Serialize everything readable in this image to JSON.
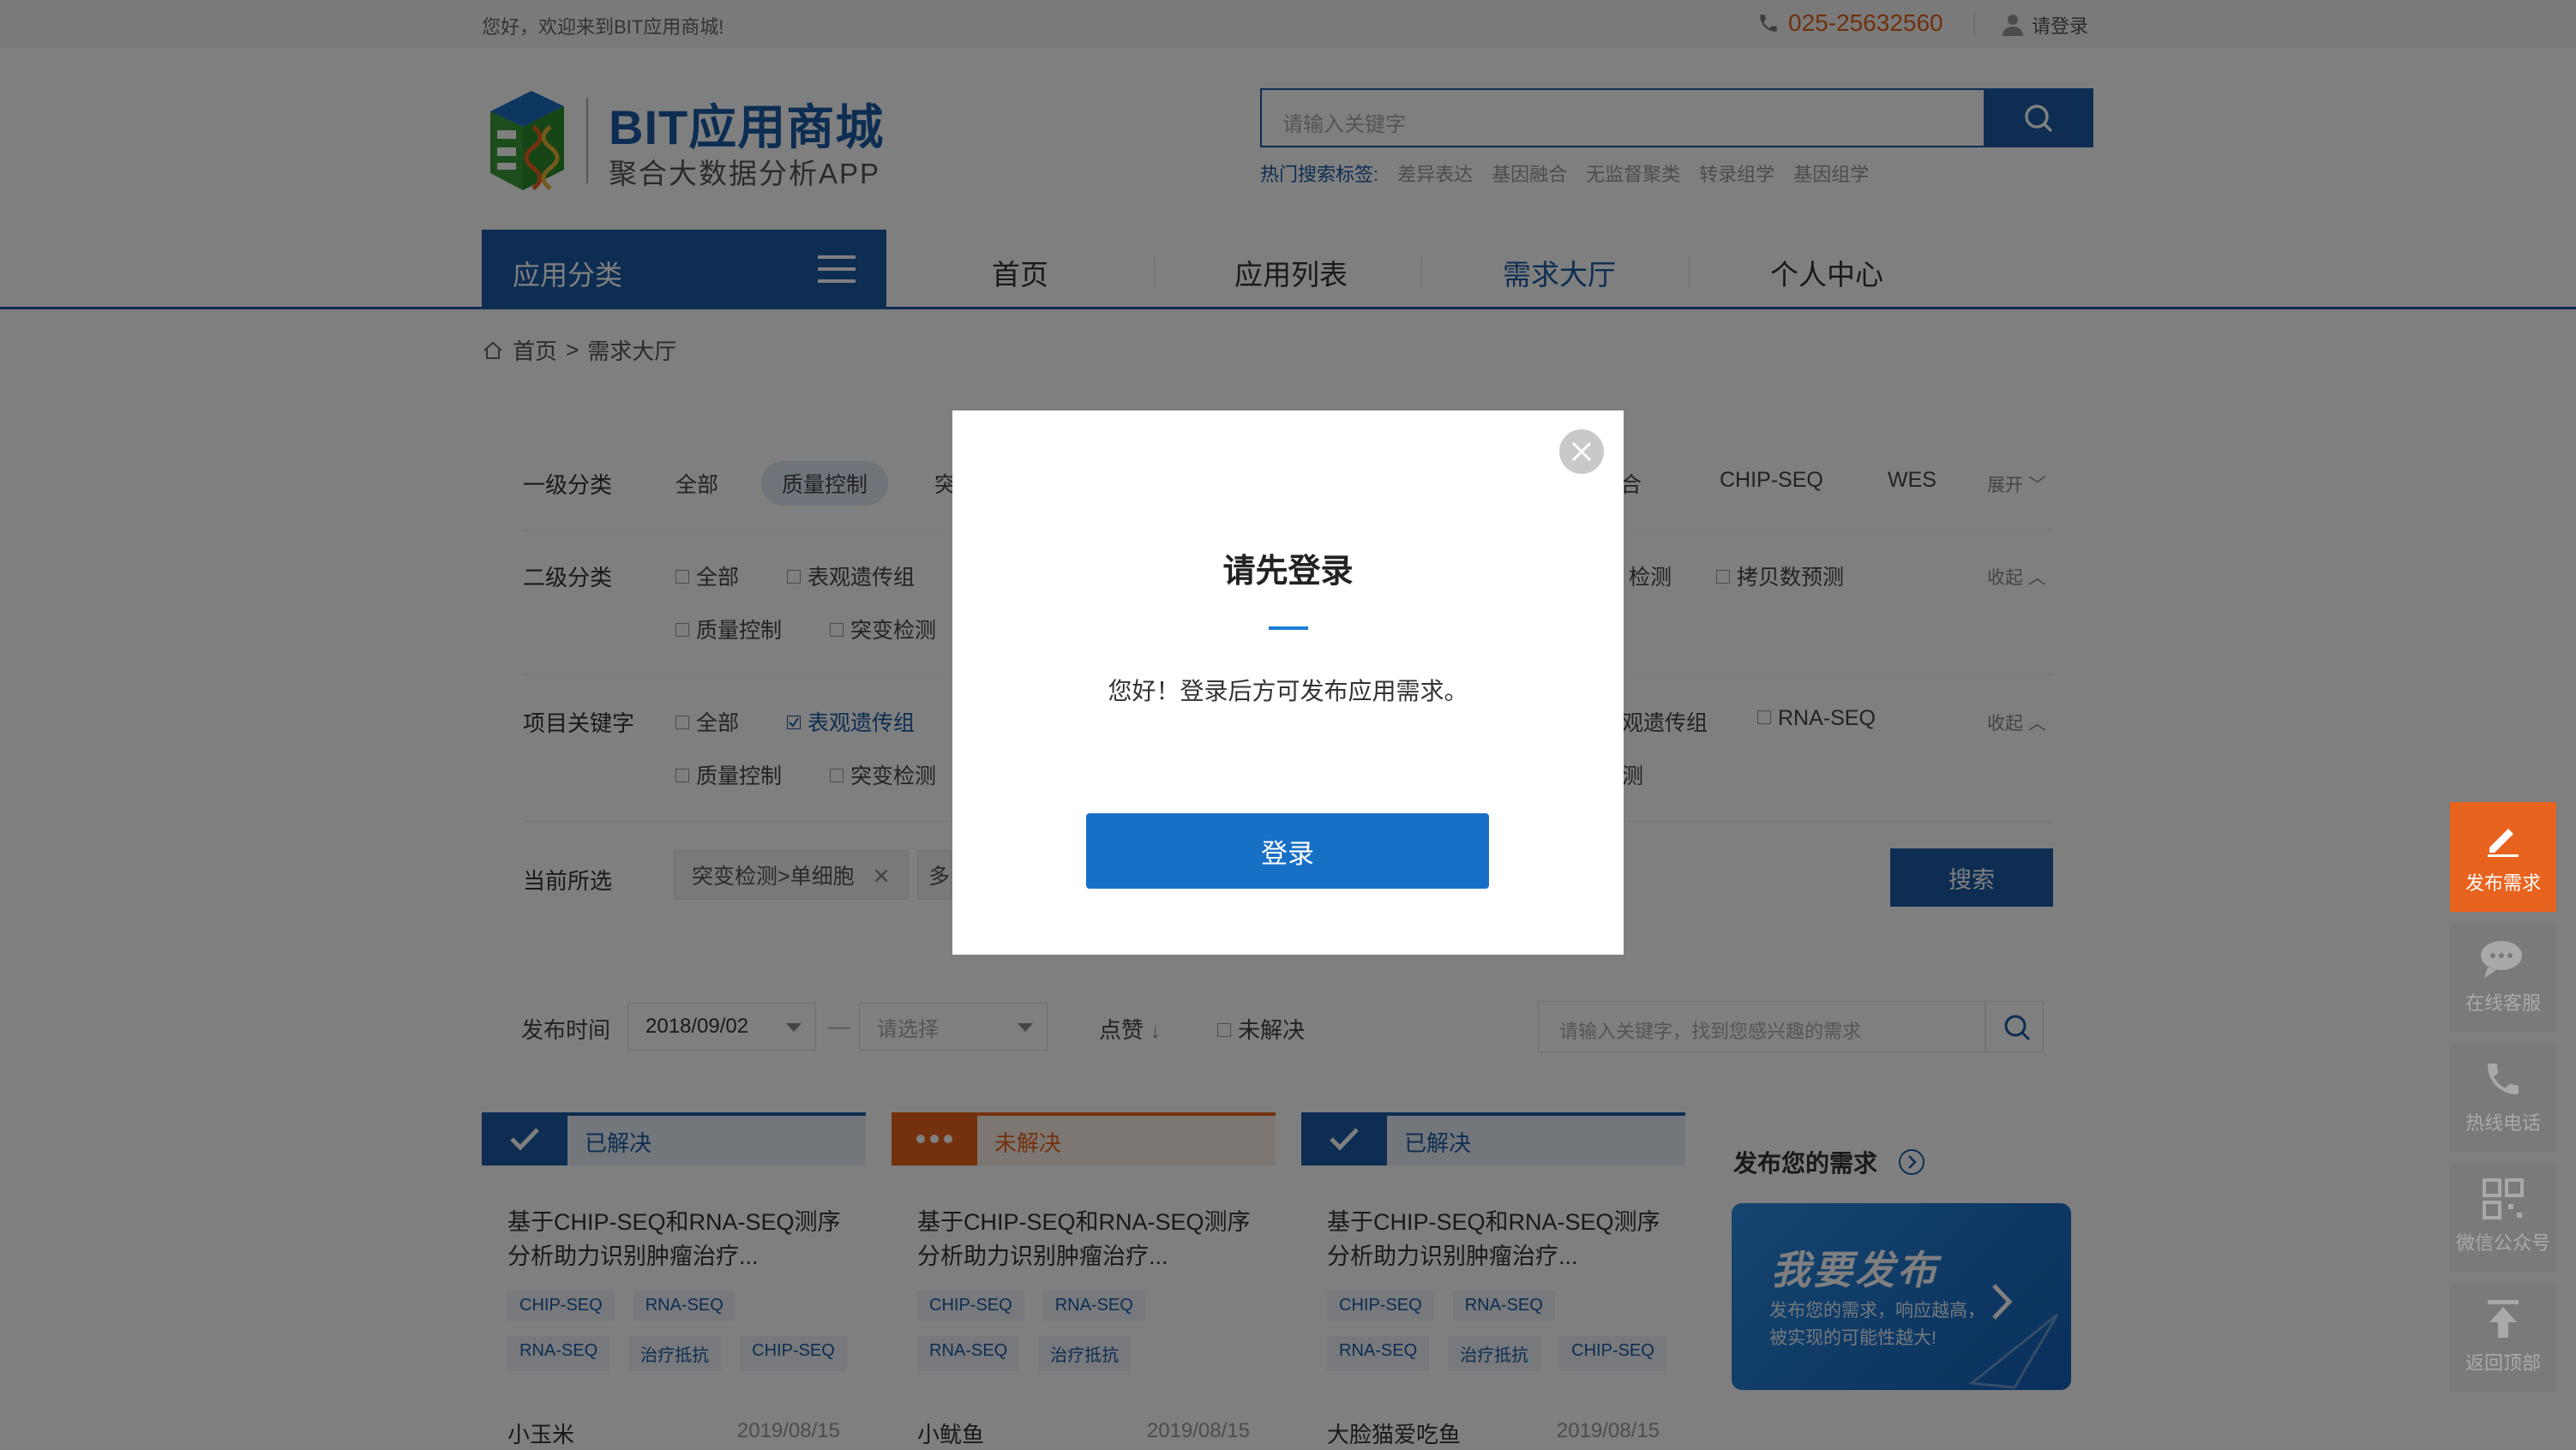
{
  "topbar": {
    "welcome": "您好，欢迎来到BIT应用商城!",
    "phone": "025-25632560",
    "login": "请登录"
  },
  "logo": {
    "name": "BIT应用商城",
    "tagline": "聚合大数据分析APP"
  },
  "search": {
    "placeholder": "请输入关键字",
    "hot_label": "热门搜索标签:",
    "hot_tags": [
      "差异表达",
      "基因融合",
      "无监督聚类",
      "转录组学",
      "基因组学"
    ]
  },
  "nav": {
    "category_label": "应用分类",
    "items": [
      "首页",
      "应用列表",
      "需求大厅",
      "个人中心"
    ],
    "active": "需求大厅"
  },
  "breadcrumb": {
    "home": "首页",
    "sep": ">",
    "current": "需求大厅"
  },
  "filters": {
    "level1": {
      "label": "一级分类",
      "items_left": [
        "全部",
        "质量控制",
        "突"
      ],
      "items_right": [
        "合",
        "CHIP-SEQ",
        "WES"
      ],
      "expand": "展开"
    },
    "level2": {
      "label": "二级分类",
      "row1_left": [
        "全部",
        "表观遗传组"
      ],
      "row1_right": [
        "检测",
        "拷贝数预测"
      ],
      "row2_left": [
        "质量控制",
        "突变检测"
      ],
      "collapse": "收起"
    },
    "keyword": {
      "label": "项目关键字",
      "row1_left": [
        "全部",
        "表观遗传组"
      ],
      "row1_right": [
        "观遗传组",
        "RNA-SEQ"
      ],
      "row2_left": [
        "质量控制",
        "突变检测"
      ],
      "row2_right": [
        "测"
      ],
      "collapse": "收起"
    },
    "current": {
      "label": "当前所选",
      "tag": "突变检测>单细胞",
      "tag2_fragment": "多"
    },
    "search_button": "搜索"
  },
  "toolbar": {
    "time_label": "发布时间",
    "date_from": "2018/09/02",
    "dash": "—",
    "date_to_placeholder": "请选择",
    "likes": "点赞",
    "unresolved": "未解决",
    "keyword_placeholder": "请输入关键字，找到您感兴趣的需求"
  },
  "cards": [
    {
      "status": "已解决",
      "title": "基于CHIP-SEQ和RNA-SEQ测序分析助力识别肿瘤治疗...",
      "tags": [
        "CHIP-SEQ",
        "RNA-SEQ",
        "RNA-SEQ",
        "治疗抵抗",
        "CHIP-SEQ"
      ],
      "user": "小玉米",
      "date": "2019/08/15"
    },
    {
      "status": "未解决",
      "title": "基于CHIP-SEQ和RNA-SEQ测序分析助力识别肿瘤治疗...",
      "tags": [
        "CHIP-SEQ",
        "RNA-SEQ",
        "RNA-SEQ",
        "治疗抵抗"
      ],
      "user": "小鱿鱼",
      "date": "2019/08/15"
    },
    {
      "status": "已解决",
      "title": "基于CHIP-SEQ和RNA-SEQ测序分析助力识别肿瘤治疗...",
      "tags": [
        "CHIP-SEQ",
        "RNA-SEQ",
        "RNA-SEQ",
        "治疗抵抗",
        "CHIP-SEQ"
      ],
      "user": "大脸猫爱吃鱼",
      "date": "2019/08/15"
    }
  ],
  "publish": {
    "title": "发布您的需求",
    "banner_big": "我要发布",
    "banner_small_1": "发布您的需求，响应越高，",
    "banner_small_2": "被实现的可能性越大!"
  },
  "sidebar": [
    "发布需求",
    "在线客服",
    "热线电话",
    "微信公众号",
    "返回顶部"
  ],
  "modal": {
    "title": "请先登录",
    "message": "您好！登录后方可发布应用需求。",
    "button": "登录"
  },
  "colors": {
    "brand": "#1b5aa5",
    "orange": "#e8631d",
    "modal_button": "#1870c6"
  }
}
